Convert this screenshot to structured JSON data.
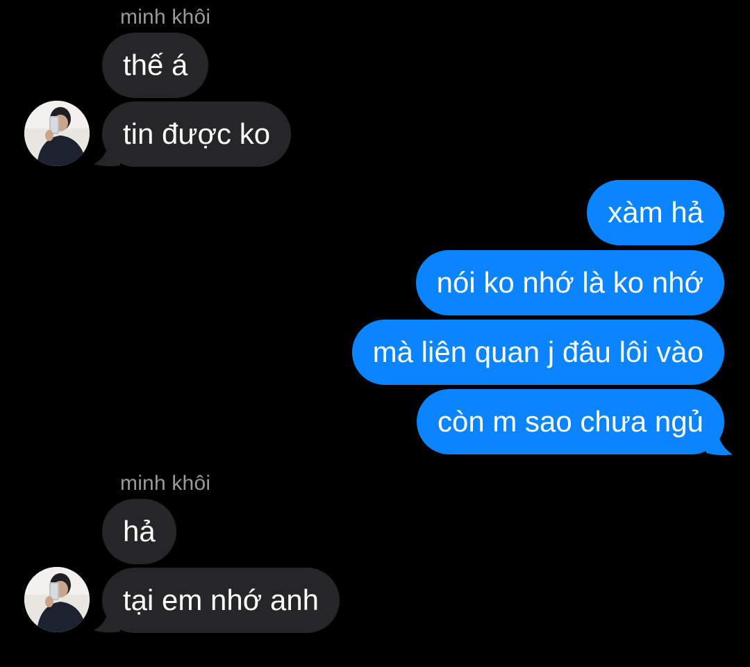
{
  "colors": {
    "background": "#000000",
    "incoming_bubble": "#262628",
    "outgoing_bubble": "#0a84ff",
    "sender_name": "#9a9a9e"
  },
  "conversation": {
    "contact_name": "minh khôi",
    "groups": [
      {
        "direction": "incoming",
        "sender": "minh khôi",
        "messages": [
          "thế á",
          "tin được ko"
        ]
      },
      {
        "direction": "outgoing",
        "messages": [
          "xàm hả",
          "nói ko nhớ là ko nhớ",
          "mà liên quan j đâu lôi vào",
          "còn m sao chưa ngủ"
        ]
      },
      {
        "direction": "incoming",
        "sender": "minh khôi",
        "messages": [
          "hả",
          "tại em nhớ anh"
        ]
      }
    ]
  },
  "icons": {
    "avatar": "contact-photo-avatar"
  }
}
